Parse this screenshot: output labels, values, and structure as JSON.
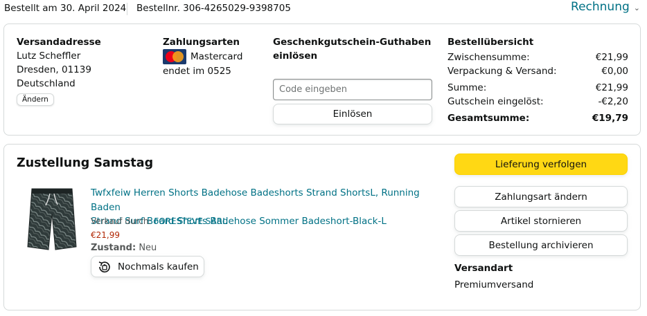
{
  "header": {
    "order_date": "Bestellt am 30. April 2024",
    "order_number": "Bestellnr. 306-4265029-9398705",
    "invoice_label": "Rechnung"
  },
  "address": {
    "heading": "Versandadresse",
    "name": "Lutz Scheffler",
    "city": "Dresden, 01139",
    "country": "Deutschland",
    "change_label": "Ändern"
  },
  "payment": {
    "heading": "Zahlungsarten",
    "card_brand": "Mastercard",
    "card_logo_text": "MasterCard",
    "expiry": "endet im 0525"
  },
  "giftcard": {
    "heading_line1": "Geschenkgutschein-Guthaben",
    "heading_line2": "einlösen",
    "placeholder": "Code eingeben",
    "redeem_label": "Einlösen"
  },
  "summary": {
    "heading": "Bestellübersicht",
    "rows": [
      {
        "label": "Zwischensumme:",
        "value": "€21,99"
      },
      {
        "label": "Verpackung & Versand:",
        "value": "€0,00"
      },
      {
        "label": "Summe:",
        "value": "€21,99"
      },
      {
        "label": "Gutschein eingelöst:",
        "value": "-€2,20"
      },
      {
        "label": "Gesamtsumme:",
        "value": "€19,79"
      }
    ]
  },
  "shipment": {
    "title": "Zustellung Samstag",
    "product": {
      "title_line1": "Twfxfeiw Herren Shorts Badehose Badeshorts Strand ShortsL, Running Baden",
      "title_line2": "Strand Surf Board Shorts Badehose Sommer Badeshort-Black-L",
      "seller_prefix": "Verkauf durch: ",
      "seller_name": "FORESTEVE SARL",
      "price": "€21,99",
      "condition_label": "Zustand:",
      "condition_value": "Neu",
      "rebuy_label": "Nochmals kaufen"
    },
    "actions": {
      "track": "Lieferung verfolgen",
      "change_payment": "Zahlungsart ändern",
      "cancel": "Artikel stornieren",
      "archive": "Bestellung archivieren"
    },
    "shipping_method_label": "Versandart",
    "shipping_method_value": "Premiumversand"
  },
  "colors": {
    "link": "#007185",
    "price": "#b12704",
    "primary_button": "#ffd814",
    "border": "#d5d9d9"
  },
  "icons": [
    "chevron-down-icon",
    "mastercard-logo",
    "rebuy-icon"
  ]
}
